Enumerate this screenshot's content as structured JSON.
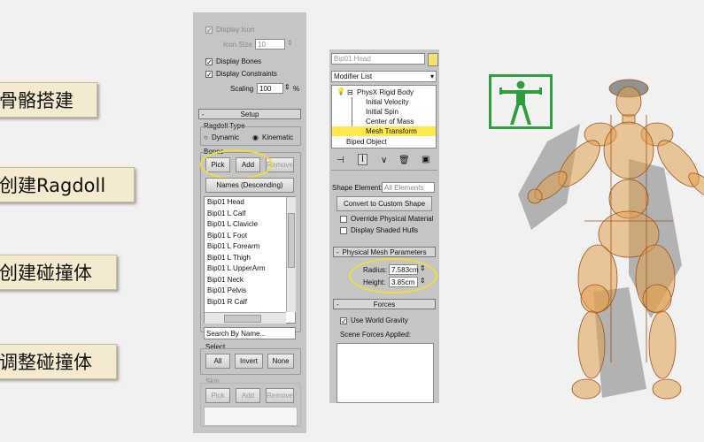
{
  "steps": [
    "骨骼搭建",
    "创建Ragdoll",
    "创建碰撞体",
    "调整碰撞体"
  ],
  "left_panel": {
    "display_icon": "Display Icon",
    "icon_size_label": "Icon Size",
    "icon_size_value": "10",
    "display_bones": "Display Bones",
    "display_constraints": "Display Constraints",
    "scaling_label": "Scaling",
    "scaling_value": "100",
    "scaling_unit": "%",
    "setup_title": "Setup",
    "ragdoll_type_label": "Ragdoll Type",
    "dynamic_label": "Dynamic",
    "kinematic_label": "Kinematic",
    "bones_label": "Bones",
    "pick_label": "Pick",
    "add_label": "Add",
    "remove_label": "Remove",
    "names_button": "Names (Descending)",
    "bones_list": [
      "Bip01 Head",
      "Bip01 L Calf",
      "Bip01 L Clavicle",
      "Bip01 L Foot",
      "Bip01 L Forearm",
      "Bip01 L Thigh",
      "Bip01 L UpperArm",
      "Bip01 Neck",
      "Bip01 Pelvis",
      "Bip01 R Calf"
    ],
    "search_placeholder": "Search By Name...",
    "select_label": "Select",
    "all_label": "All",
    "invert_label": "Invert",
    "none_label": "None",
    "skin_label": "Skin",
    "skin_pick": "Pick",
    "skin_add": "Add",
    "skin_remove": "Remove"
  },
  "modifier_panel": {
    "object_name": "Bip01 Head",
    "modifier_list": "Modifier List",
    "stack": [
      "PhysX Rigid Body",
      "Initial Velocity",
      "Initial Spin",
      "Center of Mass",
      "Mesh Transform",
      "Biped Object"
    ],
    "shape_element_label": "Shape Element:",
    "shape_element_value": "All Elements",
    "convert_button": "Convert to Custom Shape",
    "override_material": "Override Physical Material",
    "display_shaded_hulls": "Display Shaded Hulls",
    "mesh_params_title": "Physical Mesh Parameters",
    "radius_label": "Radius:",
    "radius_value": "7.583cm",
    "height_label": "Height:",
    "height_value": "3.85cm",
    "forces_title": "Forces",
    "use_world_gravity": "Use World Gravity",
    "scene_forces_label": "Scene Forces Applied:"
  },
  "colors": {
    "accent_yellow": "#f0dc3c",
    "ragdoll_orange": "#c8781e",
    "icon_green": "#2e9e3c",
    "selection_yellow": "#ffe84a"
  }
}
